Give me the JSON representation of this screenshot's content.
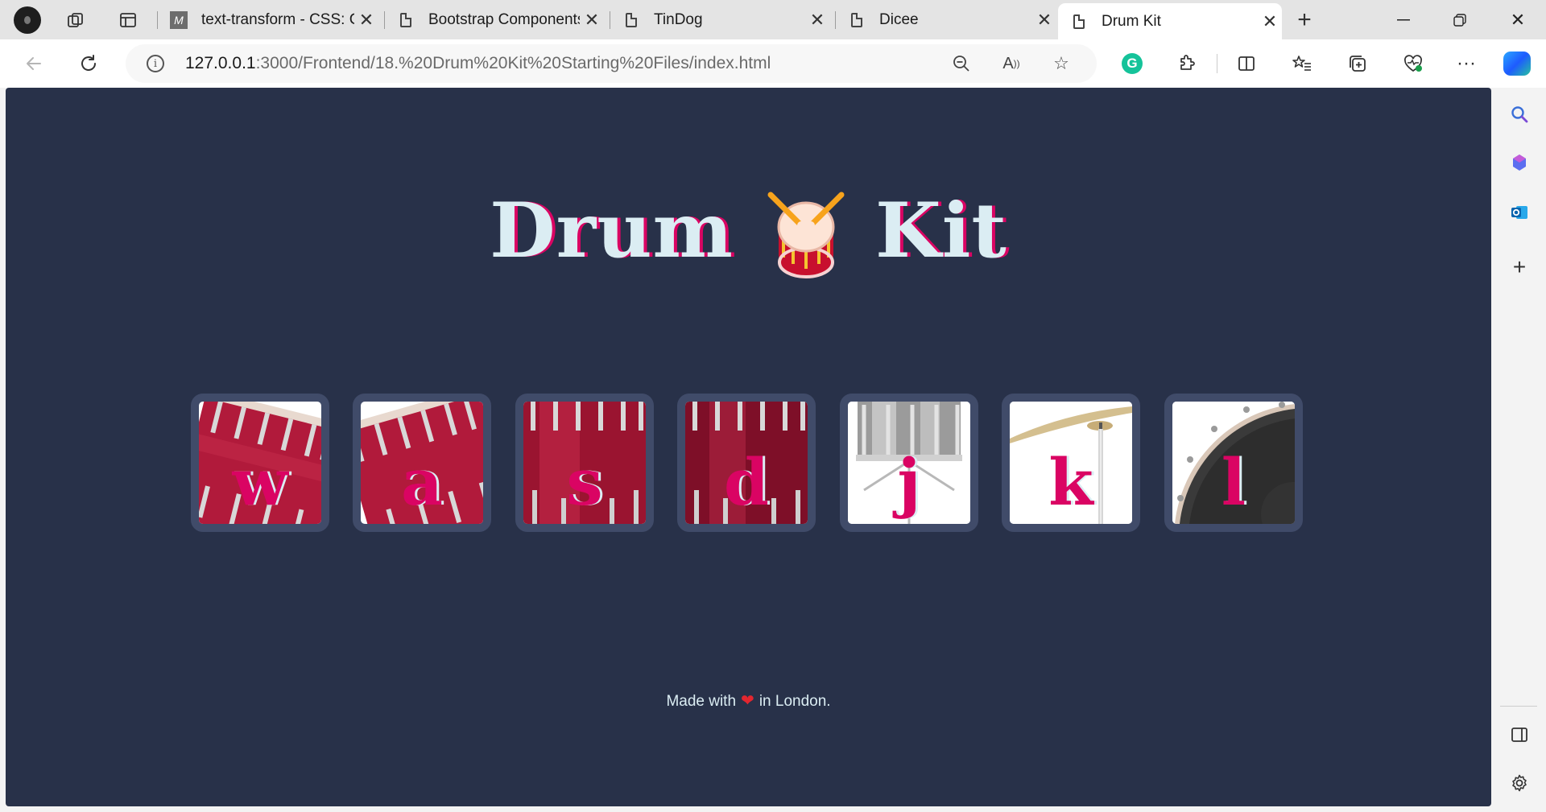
{
  "browser": {
    "tabs": [
      {
        "title": "text-transform - CSS: C",
        "favicon": "m-icon"
      },
      {
        "title": "Bootstrap Components",
        "favicon": "document-icon"
      },
      {
        "title": "TinDog",
        "favicon": "document-icon"
      },
      {
        "title": "Dicee",
        "favicon": "document-icon"
      },
      {
        "title": "Drum Kit",
        "favicon": "document-icon",
        "active": true
      }
    ],
    "url_host": "127.0.0.1",
    "url_rest": ":3000/Frontend/18.%20Drum%20Kit%20Starting%20Files/index.html"
  },
  "page": {
    "title_left": "Drum",
    "title_right": "Kit",
    "drums": [
      {
        "key": "w",
        "art": "tom-1"
      },
      {
        "key": "a",
        "art": "tom-2"
      },
      {
        "key": "s",
        "art": "tom-3"
      },
      {
        "key": "d",
        "art": "tom-4"
      },
      {
        "key": "j",
        "art": "snare"
      },
      {
        "key": "k",
        "art": "crash"
      },
      {
        "key": "l",
        "art": "kick-bass"
      }
    ],
    "footer_prefix": "Made with",
    "footer_suffix": "in London."
  },
  "colors": {
    "background": "#283149",
    "drum_border": "#404b69",
    "text_light": "#dbedf3",
    "accent_pink": "#da0463"
  }
}
